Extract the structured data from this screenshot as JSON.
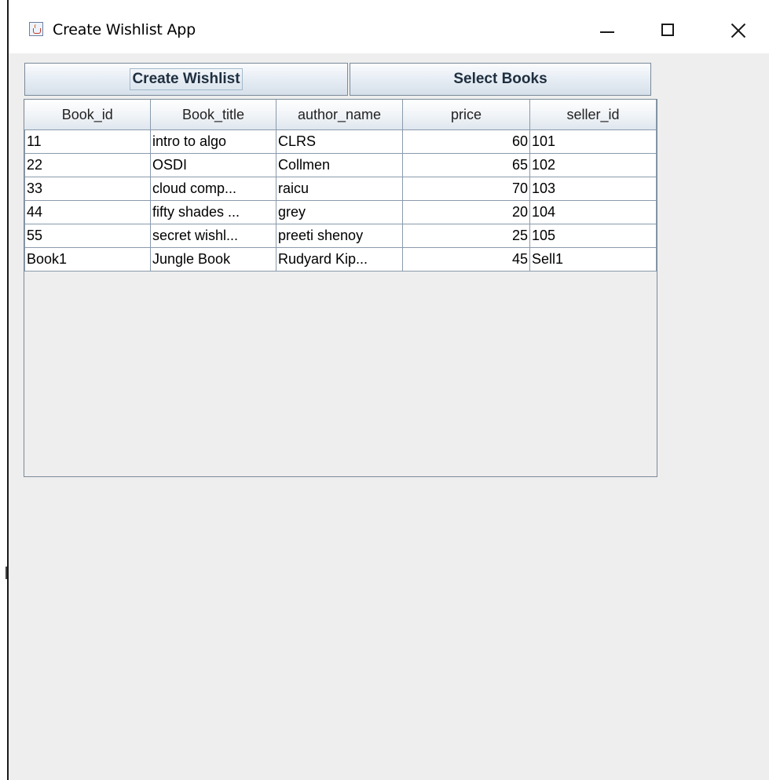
{
  "window": {
    "title": "Create Wishlist App",
    "icon": "java-cup-icon"
  },
  "buttons": {
    "create_wishlist": "Create Wishlist",
    "select_books": "Select Books"
  },
  "table": {
    "columns": [
      "Book_id",
      "Book_title",
      "author_name",
      "price",
      "seller_id"
    ],
    "rows": [
      [
        "11",
        "intro to algo",
        "CLRS",
        "60",
        "101"
      ],
      [
        "22",
        "OSDI",
        "Collmen",
        "65",
        "102"
      ],
      [
        "33",
        "cloud comp...",
        "raicu",
        "70",
        "103"
      ],
      [
        "44",
        "fifty shades ...",
        "grey",
        "20",
        "104"
      ],
      [
        "55",
        "secret wishl...",
        "preeti shenoy",
        "25",
        "105"
      ],
      [
        "Book1",
        "Jungle Book",
        "Rudyard Kip...",
        "45",
        "Sell1"
      ]
    ]
  },
  "colors": {
    "window_bg": "#eeeeee",
    "titlebar_bg": "#ffffff",
    "grid_line": "#8a9aab",
    "button_border": "#7a8a99"
  }
}
